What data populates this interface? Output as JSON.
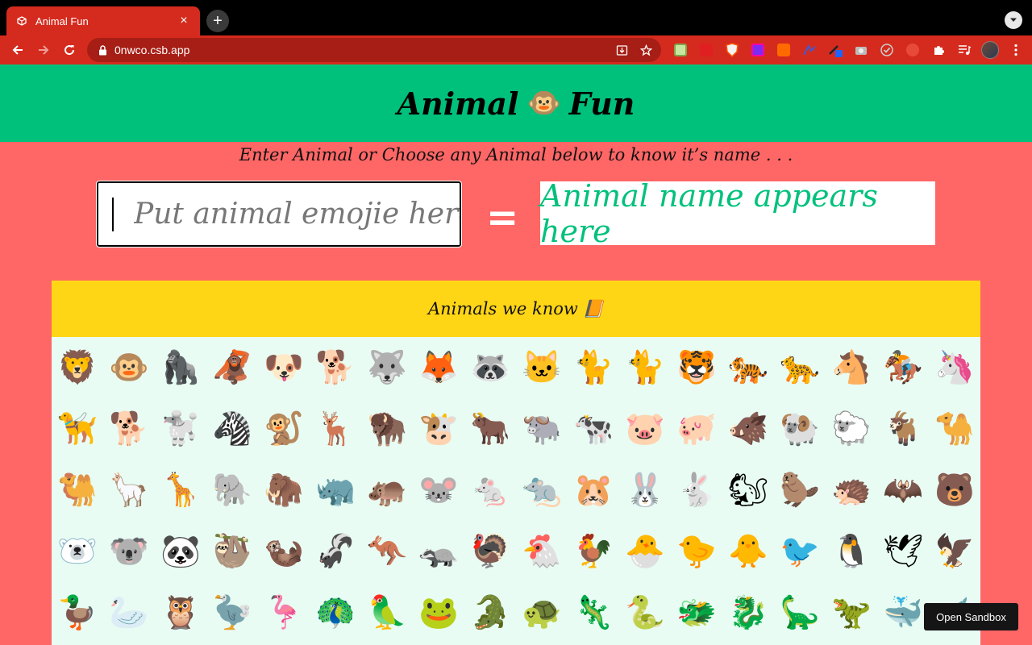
{
  "browser": {
    "tab_title": "Animal Fun",
    "url": "0nwco.csb.app"
  },
  "page": {
    "title_left": "Animal",
    "title_emoji": "🐵",
    "title_right": "Fun",
    "subtitle": "Enter Animal or Choose any Animal below to know it’s name . . .",
    "input_placeholder": "Put animal emojie here",
    "equals": "=",
    "output_text": "Animal name appears here",
    "known_title": "Animals we know",
    "known_emoji": "📙",
    "animals": [
      "🦁",
      "🐵",
      "🦍",
      "🦧",
      "🐶",
      "🐕",
      "🐺",
      "🦊",
      "🦝",
      "🐱",
      "🐈",
      "🐈",
      "🐯",
      "🐅",
      "🐆",
      "🐴",
      "🏇",
      "🦄",
      "🦮",
      "🐕",
      "🐩",
      "🦓",
      "🐒",
      "🦌",
      "🦬",
      "🐮",
      "🐂",
      "🐃",
      "🐄",
      "🐷",
      "🐖",
      "🐗",
      "🐏",
      "🐑",
      "🐐",
      "🐪",
      "🐫",
      "🦙",
      "🦒",
      "🐘",
      "🦣",
      "🦏",
      "🦛",
      "🐭",
      "🐁",
      "🐀",
      "🐹",
      "🐰",
      "🐇",
      "🐿",
      "🦫",
      "🦔",
      "🦇",
      "🐻",
      "🐻‍❄️",
      "🐨",
      "🐼",
      "🦥",
      "🦦",
      "🦨",
      "🦘",
      "🦡",
      "🦃",
      "🐔",
      "🐓",
      "🐣",
      "🐤",
      "🐥",
      "🐦",
      "🐧",
      "🕊",
      "🦅",
      "🦆",
      "🦢",
      "🦉",
      "🦤",
      "🦩",
      "🦚",
      "🦜",
      "🐸",
      "🐊",
      "🐢",
      "🦎",
      "🐍",
      "🐲",
      "🐉",
      "🦕",
      "🦖",
      "🐳",
      "🐋"
    ],
    "open_sandbox": "Open Sandbox"
  },
  "colors": {
    "header_bg": "#00c17c",
    "page_bg": "#ff6666",
    "known_header_bg": "#ffd616",
    "chrome_red": "#d52b1e"
  }
}
